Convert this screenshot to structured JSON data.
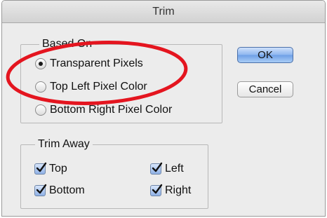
{
  "window": {
    "title": "Trim"
  },
  "based_on": {
    "legend": "Based On",
    "options": [
      {
        "label": "Transparent Pixels",
        "selected": true
      },
      {
        "label": "Top Left Pixel Color",
        "selected": false
      },
      {
        "label": "Bottom Right Pixel Color",
        "selected": false
      }
    ]
  },
  "trim_away": {
    "legend": "Trim Away",
    "checks": [
      {
        "label": "Top",
        "checked": true
      },
      {
        "label": "Bottom",
        "checked": true
      },
      {
        "label": "Left",
        "checked": true
      },
      {
        "label": "Right",
        "checked": true
      }
    ]
  },
  "buttons": {
    "ok": "OK",
    "cancel": "Cancel"
  },
  "annotation": {
    "color": "#e4151f"
  },
  "colors": {
    "window_bg": "#ececec",
    "default_button": "#8db6ef"
  }
}
